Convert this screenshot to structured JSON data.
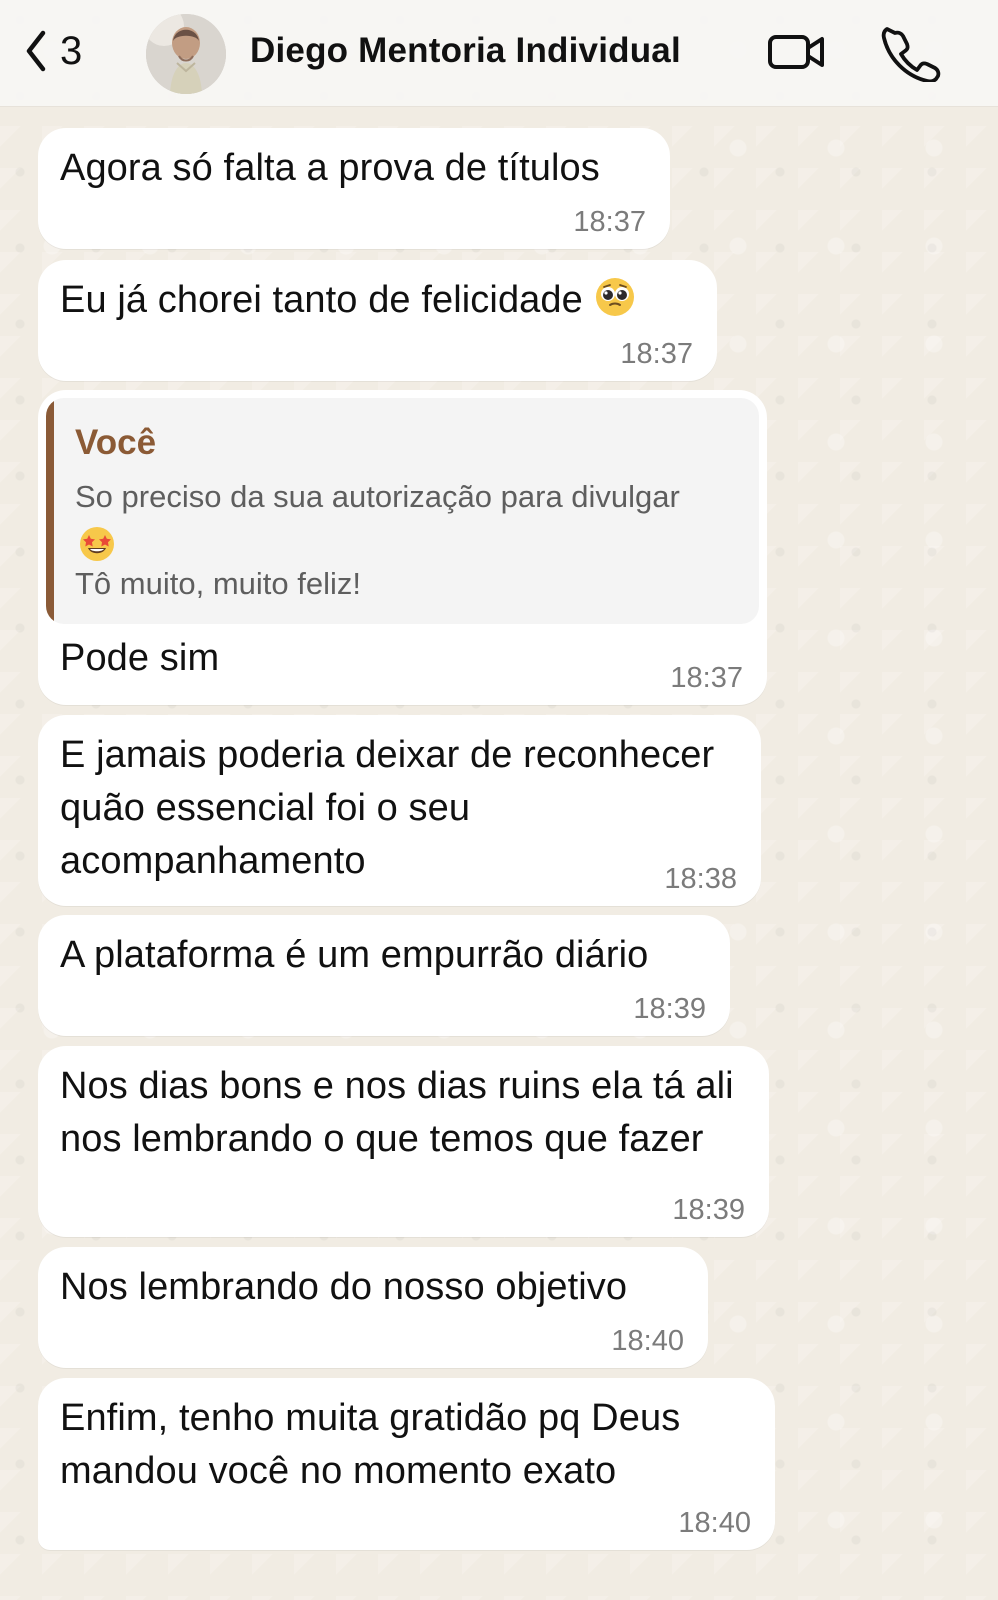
{
  "header": {
    "back_count": "3",
    "contact_name": "Diego Mentoria Individual"
  },
  "colors": {
    "background": "#f1ece3",
    "bubble": "#ffffff",
    "reply_accent": "#8a5a37",
    "reply_name": "#8b5a35",
    "timestamp": "#7b7b7b"
  },
  "icons": {
    "back": "chevron-left-icon",
    "video": "video-call-icon",
    "phone": "phone-icon"
  },
  "messages": [
    {
      "text": "Agora só falta a prova de títulos",
      "time": "18:37"
    },
    {
      "text": "Eu já chorei tanto de felicidade",
      "time": "18:37"
    },
    {
      "reply": {
        "author": "Você",
        "line1": "So preciso da sua autorização para divulgar",
        "line2": "Tô muito, muito feliz!"
      },
      "text": "Pode sim",
      "time": "18:37"
    },
    {
      "text": "E jamais poderia deixar de reconhecer quão essencial foi o seu acompanhamento",
      "time": "18:38"
    },
    {
      "text": "A plataforma é um empurrão diário",
      "time": "18:39"
    },
    {
      "text": "Nos dias bons e nos dias ruins ela tá ali nos lembrando o que temos que fazer",
      "time": "18:39"
    },
    {
      "text": "Nos lembrando do nosso objetivo",
      "time": "18:40"
    },
    {
      "text": "Enfim, tenho muita gratidão pq Deus mandou você no momento exato",
      "time": "18:40"
    }
  ]
}
